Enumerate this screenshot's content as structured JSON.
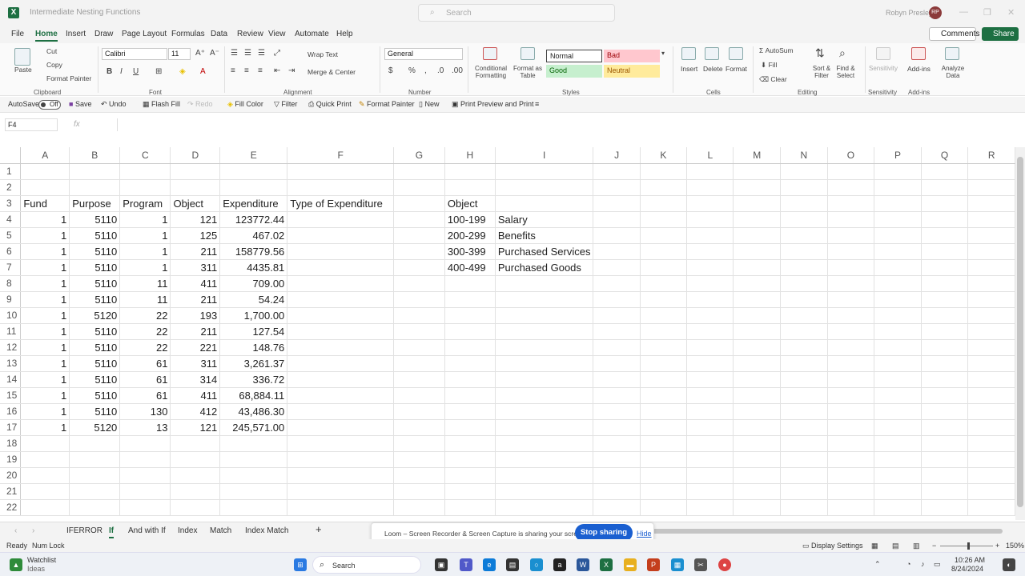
{
  "app": {
    "title": "Intermediate Nesting Functions",
    "search_placeholder": "Search",
    "user_name": "Robyn Presley",
    "user_initials": "RP"
  },
  "menu": {
    "items": [
      "File",
      "Home",
      "Insert",
      "Draw",
      "Page Layout",
      "Formulas",
      "Data",
      "Review",
      "View",
      "Automate",
      "Help"
    ],
    "active": "Home",
    "comments": "Comments",
    "share": "Share"
  },
  "ribbon": {
    "clipboard": {
      "paste": "Paste",
      "cut": "Cut",
      "copy": "Copy",
      "format_painter": "Format Painter",
      "group": "Clipboard"
    },
    "font": {
      "name": "Calibri",
      "size": "11",
      "group": "Font"
    },
    "alignment": {
      "wrap_text": "Wrap Text",
      "merge_center": "Merge & Center",
      "group": "Alignment"
    },
    "number": {
      "format": "General",
      "group": "Number"
    },
    "styles": {
      "conditional_formatting": "Conditional Formatting",
      "format_as_table": "Format as Table",
      "normal": "Normal",
      "bad": "Bad",
      "good": "Good",
      "neutral": "Neutral",
      "group": "Styles"
    },
    "cells": {
      "insert": "Insert",
      "delete": "Delete",
      "format": "Format",
      "group": "Cells"
    },
    "editing": {
      "autosum": "AutoSum",
      "fill": "Fill",
      "clear": "Clear",
      "sort_filter": "Sort & Filter",
      "find_select": "Find & Select",
      "group": "Editing"
    },
    "sensitivity": {
      "label": "Sensitivity",
      "group": "Sensitivity"
    },
    "addins": {
      "label": "Add-ins",
      "group": "Add-ins"
    },
    "analyze": {
      "label": "Analyze Data"
    }
  },
  "qat": {
    "autosave": "AutoSave",
    "autosave_state": "Off",
    "items": [
      "Save",
      "Undo",
      "Flash Fill",
      "Redo",
      "Fill Color",
      "Filter",
      "Quick Print",
      "Format Painter",
      "New",
      "Print Preview and Print"
    ]
  },
  "formula_bar": {
    "cell_ref": "F4",
    "fx": "fx",
    "value": ""
  },
  "sheet": {
    "columns": [
      "A",
      "B",
      "C",
      "D",
      "E",
      "F",
      "G",
      "H",
      "I",
      "J",
      "K",
      "L",
      "M",
      "N",
      "O",
      "P",
      "Q",
      "R"
    ],
    "rows": [
      [
        "",
        "",
        "",
        "",
        "",
        "",
        "",
        "",
        "",
        ""
      ],
      [
        "",
        "",
        "",
        "",
        "",
        "",
        "",
        "",
        "",
        ""
      ],
      [
        "Fund",
        "Purpose",
        "Program",
        "Object",
        "Expenditure",
        "Type of Expenditure",
        "",
        "Object",
        "",
        ""
      ],
      [
        "1",
        "5110",
        "1",
        "121",
        "123772.44",
        "",
        "",
        "100-199",
        "Salary",
        ""
      ],
      [
        "1",
        "5110",
        "1",
        "125",
        "467.02",
        "",
        "",
        "200-299",
        "Benefits",
        ""
      ],
      [
        "1",
        "5110",
        "1",
        "211",
        "158779.56",
        "",
        "",
        "300-399",
        "Purchased Services",
        ""
      ],
      [
        "1",
        "5110",
        "1",
        "311",
        "4435.81",
        "",
        "",
        "400-499",
        "Purchased Goods",
        ""
      ],
      [
        "1",
        "5110",
        "11",
        "411",
        "709.00",
        "",
        "",
        "",
        "",
        ""
      ],
      [
        "1",
        "5110",
        "11",
        "211",
        "54.24",
        "",
        "",
        "",
        "",
        ""
      ],
      [
        "1",
        "5120",
        "22",
        "193",
        "1,700.00",
        "",
        "",
        "",
        "",
        ""
      ],
      [
        "1",
        "5110",
        "22",
        "211",
        "127.54",
        "",
        "",
        "",
        "",
        ""
      ],
      [
        "1",
        "5110",
        "22",
        "221",
        "148.76",
        "",
        "",
        "",
        "",
        ""
      ],
      [
        "1",
        "5110",
        "61",
        "311",
        "3,261.37",
        "",
        "",
        "",
        "",
        ""
      ],
      [
        "1",
        "5110",
        "61",
        "314",
        "336.72",
        "",
        "",
        "",
        "",
        ""
      ],
      [
        "1",
        "5110",
        "61",
        "411",
        "68,884.11",
        "",
        "",
        "",
        "",
        ""
      ],
      [
        "1",
        "5110",
        "130",
        "412",
        "43,486.30",
        "",
        "",
        "",
        "",
        ""
      ],
      [
        "1",
        "5120",
        "13",
        "121",
        "245,571.00",
        "",
        "",
        "",
        "",
        ""
      ],
      [
        "",
        "",
        "",
        "",
        "",
        "",
        "",
        "",
        "",
        ""
      ],
      [
        "",
        "",
        "",
        "",
        "",
        "",
        "",
        "",
        "",
        ""
      ],
      [
        "",
        "",
        "",
        "",
        "",
        "",
        "",
        "",
        "",
        ""
      ],
      [
        "",
        "",
        "",
        "",
        "",
        "",
        "",
        "",
        "",
        ""
      ],
      [
        "",
        "",
        "",
        "",
        "",
        "",
        "",
        "",
        "",
        ""
      ]
    ]
  },
  "sheet_tabs": {
    "tabs": [
      "IFERROR",
      "If",
      "And with If",
      "Index",
      "Match",
      "Index Match"
    ],
    "active": "If"
  },
  "loom": {
    "message": "Loom – Screen Recorder & Screen Capture is sharing your screen.",
    "stop": "Stop sharing",
    "hide": "Hide"
  },
  "status": {
    "ready": "Ready",
    "num_lock": "Num Lock",
    "display_settings": "Display Settings",
    "zoom": "150%"
  },
  "taskbar": {
    "watchlist": "Watchlist",
    "ideas": "Ideas",
    "search": "Search",
    "time": "10:26 AM",
    "date": "8/24/2024"
  }
}
